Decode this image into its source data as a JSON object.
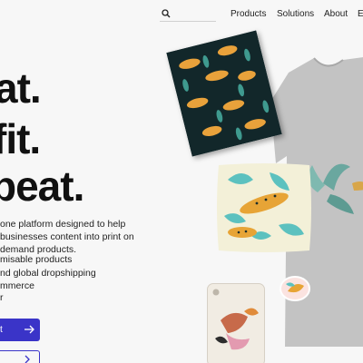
{
  "header": {
    "search_placeholder": "",
    "nav": [
      "Products",
      "Solutions",
      "About",
      "E"
    ]
  },
  "hero": {
    "lines": [
      "at.",
      "fit.",
      "beat."
    ],
    "description": "one platform designed to help businesses content into print on demand products.",
    "features": [
      "misable products",
      "nd global dropshipping",
      "mmerce",
      "r"
    ],
    "cta_primary": "t",
    "cta_primary_icon": "arrow-right-icon",
    "cta_secondary_icon": "chevron-right-icon"
  },
  "colors": {
    "accent": "#3a34c8",
    "tee": "#c3c3c3",
    "poster": "#12272a",
    "pillow": "#f3f0d8"
  }
}
